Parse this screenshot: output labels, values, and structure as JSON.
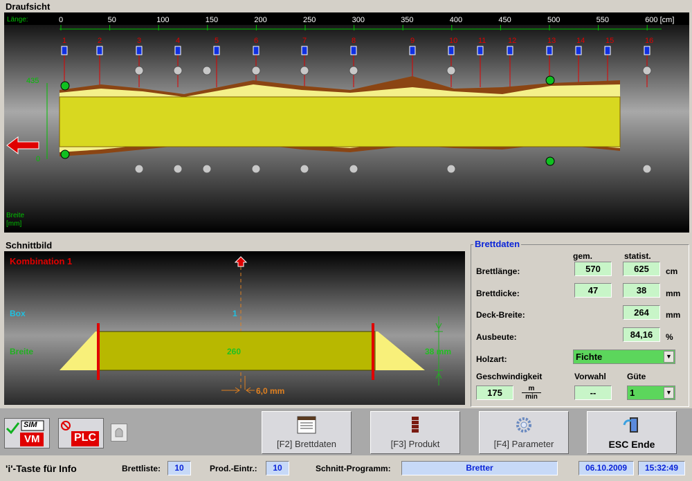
{
  "top_panel": {
    "title": "Draufsicht",
    "length_label": "Länge:",
    "scale_ticks": [
      "0",
      "50",
      "100",
      "150",
      "200",
      "250",
      "300",
      "350",
      "400",
      "450",
      "500",
      "550",
      "600 [cm]"
    ],
    "positions": [
      "1",
      "2",
      "3",
      "4",
      "5",
      "6",
      "7",
      "8",
      "9",
      "10",
      "11",
      "12",
      "13",
      "14",
      "15",
      "16"
    ],
    "width_top_value": "435",
    "width_bottom_value": "0",
    "width_label_line1": "Breite",
    "width_label_line2": "[mm]"
  },
  "cut_panel": {
    "title": "Schnittbild",
    "combination": "Kombination  1",
    "box_label": "Box",
    "box_value": "1",
    "width_label": "Breite",
    "width_value": "260",
    "height_value": "38 mm",
    "kerf_value": "6,0 mm"
  },
  "board_data": {
    "title": "Brettdaten",
    "col_measured": "gem.",
    "col_stat": "statist.",
    "length_label": "Brettlänge:",
    "length_measured": "570",
    "length_stat": "625",
    "length_unit": "cm",
    "thickness_label": "Brettdicke:",
    "thickness_measured": "47",
    "thickness_stat": "38",
    "thickness_unit": "mm",
    "deck_width_label": "Deck-Breite:",
    "deck_width_stat": "264",
    "deck_width_unit": "mm",
    "yield_label": "Ausbeute:",
    "yield_stat": "84,16",
    "yield_unit": "%",
    "wood_label": "Holzart:",
    "wood_value": "Fichte",
    "speed_label": "Geschwindigkeit",
    "speed_value": "175",
    "speed_unit_num": "m",
    "speed_unit_den": "min",
    "preselect_label": "Vorwahl",
    "preselect_value": "--",
    "quality_label": "Güte",
    "quality_value": "1"
  },
  "toolbar": {
    "sim_label": "SIM",
    "vm_label": "VM",
    "plc_label": "PLC",
    "btn_f2": "[F2] Brettdaten",
    "btn_f3": "[F3] Produkt",
    "btn_f4": "[F4] Parameter",
    "btn_esc": "ESC Ende"
  },
  "status_bar": {
    "info": "'i'-Taste für Info",
    "board_list_label": "Brettliste:",
    "board_list_value": "10",
    "prod_label": "Prod.-Eintr.:",
    "prod_value": "10",
    "program_label": "Schnitt-Programm:",
    "program_value": "Bretter",
    "date": "06.10.2009",
    "time": "15:32:49"
  },
  "colors": {
    "board_yellow": "#d8d820",
    "bark_brown": "#8b4513",
    "scale_green": "#00c000",
    "marker_red": "#e00000",
    "sensor_blue": "#1030e0"
  }
}
